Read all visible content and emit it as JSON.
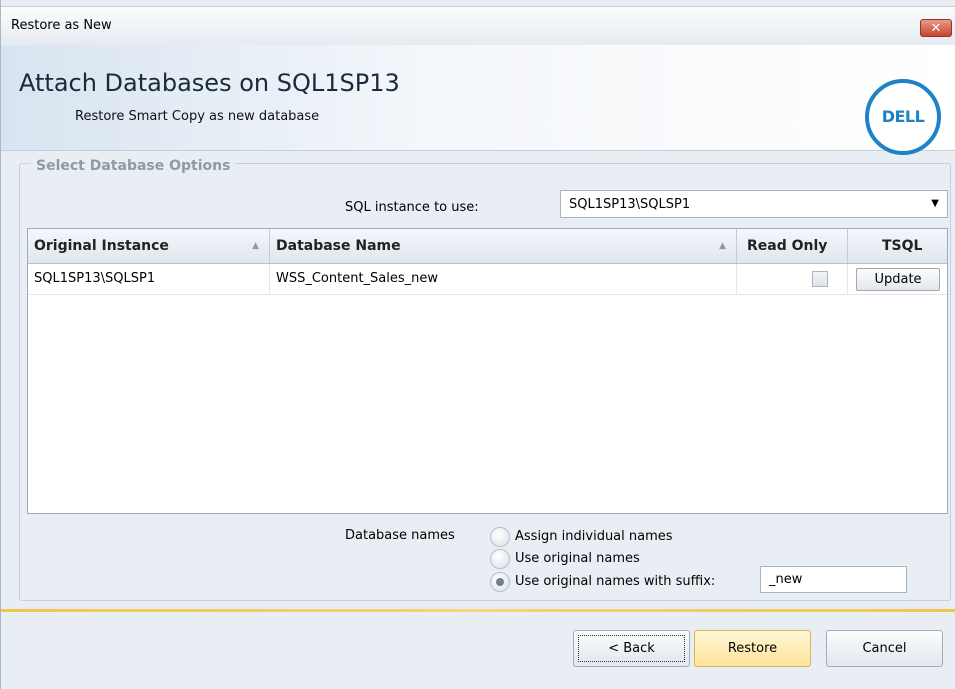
{
  "window": {
    "title": "Restore as New",
    "close_label": "✕"
  },
  "header": {
    "title": "Attach Databases on SQL1SP13",
    "subtitle": "Restore Smart Copy as new database",
    "logo_text": "DELL"
  },
  "options": {
    "legend": "Select Database Options",
    "sql_instance_label": "SQL instance to use:",
    "sql_instance_value": "SQL1SP13\\SQLSP1"
  },
  "grid": {
    "columns": [
      "Original Instance",
      "Database Name",
      "Read Only",
      "TSQL"
    ],
    "rows": [
      {
        "original_instance": "SQL1SP13\\SQLSP1",
        "database_name": "WSS_Content_Sales_new",
        "read_only": false,
        "tsql_button": "Update"
      }
    ]
  },
  "database_names": {
    "label": "Database names",
    "options": [
      "Assign individual names",
      "Use original names",
      "Use original names with suffix:"
    ],
    "selected_index": 2,
    "suffix_value": "_new"
  },
  "buttons": {
    "back": "< Back",
    "restore": "Restore",
    "cancel": "Cancel"
  },
  "colors": {
    "accent": "#1d82c6",
    "separator": "#f2c64a"
  }
}
